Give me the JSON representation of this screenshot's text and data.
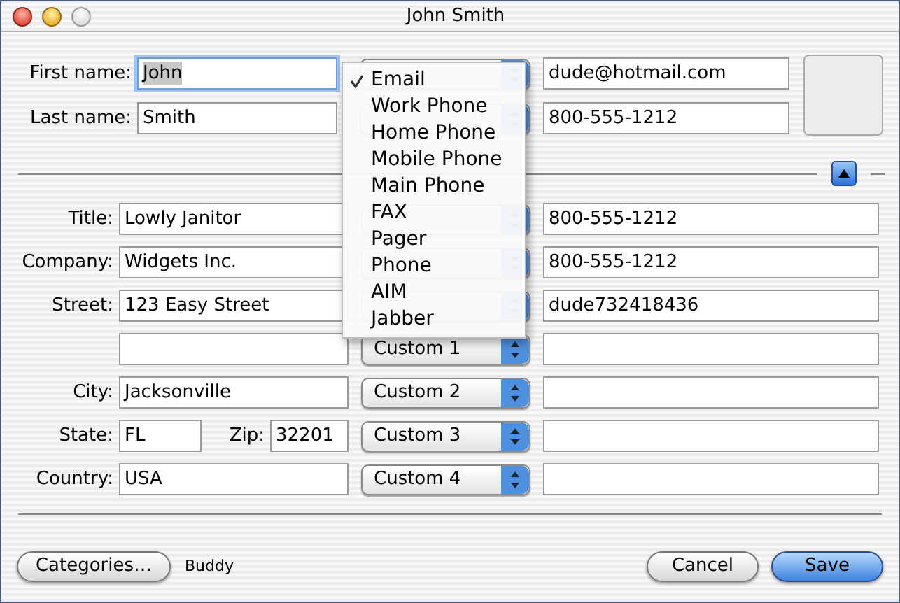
{
  "window": {
    "title": "John Smith"
  },
  "name_rows": [
    {
      "label": "First name:",
      "value": "John",
      "focused": true,
      "contact": "dude@hotmail.com"
    },
    {
      "label": "Last name:",
      "value": "Smith",
      "focused": false,
      "contact": "800-555-1212"
    }
  ],
  "address_rows": [
    {
      "kind": "field",
      "label": "Title:",
      "value": "Lowly Janitor",
      "contact": "800-555-1212"
    },
    {
      "kind": "field",
      "label": "Company:",
      "value": "Widgets Inc.",
      "contact": "800-555-1212"
    },
    {
      "kind": "field",
      "label": "Street:",
      "value": "123 Easy Street",
      "contact": "dude732418436"
    },
    {
      "kind": "field",
      "popup": "Custom 1"
    },
    {
      "kind": "field",
      "label": "City:",
      "value": "Jacksonville",
      "popup": "Custom 2"
    },
    {
      "kind": "pair",
      "label": "State:",
      "value": "FL",
      "label_2": "Zip:",
      "value_2": "32201",
      "popup": "Custom 3"
    },
    {
      "kind": "field",
      "label": "Country:",
      "value": "USA",
      "popup": "Custom 4"
    }
  ],
  "menu": {
    "items": [
      {
        "label": "Email",
        "selected": true
      },
      {
        "label": "Work Phone",
        "selected": false
      },
      {
        "label": "Home Phone",
        "selected": false
      },
      {
        "label": "Mobile Phone",
        "selected": false
      },
      {
        "label": "Main Phone",
        "selected": false
      },
      {
        "label": "FAX",
        "selected": false
      },
      {
        "label": "Pager",
        "selected": false
      },
      {
        "label": "Phone",
        "selected": false
      },
      {
        "label": "AIM",
        "selected": false
      },
      {
        "label": "Jabber",
        "selected": false
      }
    ]
  },
  "footer": {
    "categories_button": "Categories…",
    "category": "Buddy",
    "buttons": [
      {
        "label": "Cancel",
        "default": false
      },
      {
        "label": "Save",
        "default": true
      }
    ]
  }
}
